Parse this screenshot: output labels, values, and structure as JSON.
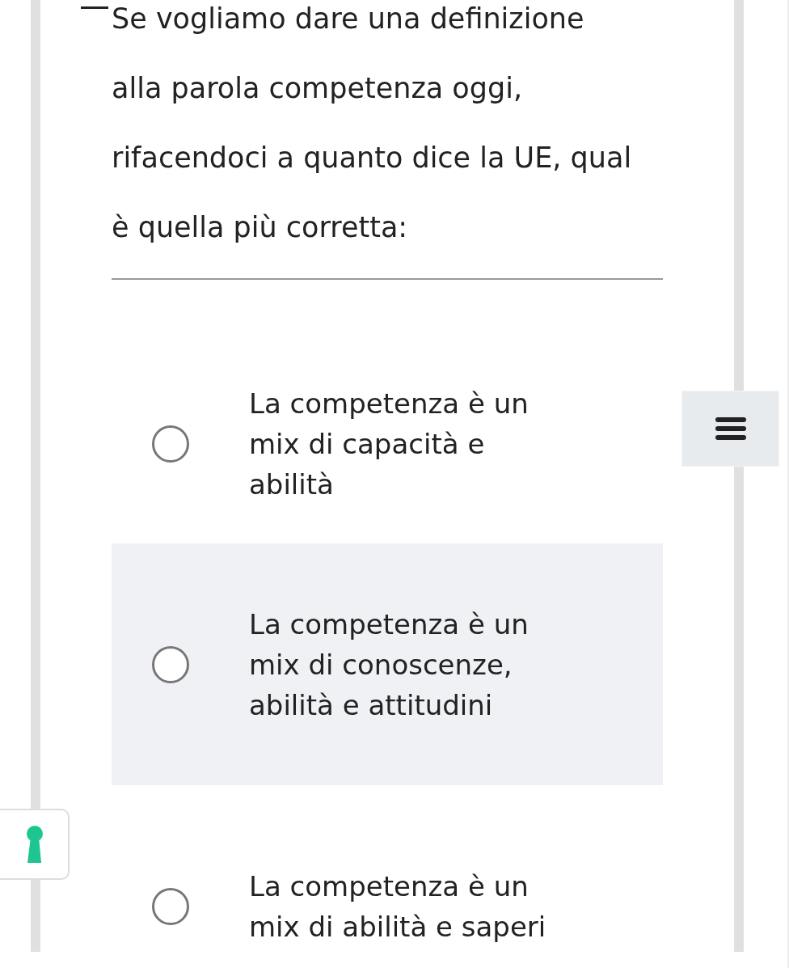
{
  "question": {
    "lines": [
      "Se vogliamo dare una definizione",
      "alla parola competenza oggi,",
      "rifacendoci a quanto dice la UE, qual",
      "è quella più corretta:"
    ]
  },
  "options": [
    {
      "text": "La competenza è un mix di capacità e abilità",
      "selected": false,
      "highlighted": false
    },
    {
      "text": "La competenza è un mix di conoscenze, abilità e attitudini",
      "selected": false,
      "highlighted": true
    },
    {
      "text": "La competenza è un mix di abilità e saperi",
      "selected": false,
      "highlighted": false
    }
  ]
}
